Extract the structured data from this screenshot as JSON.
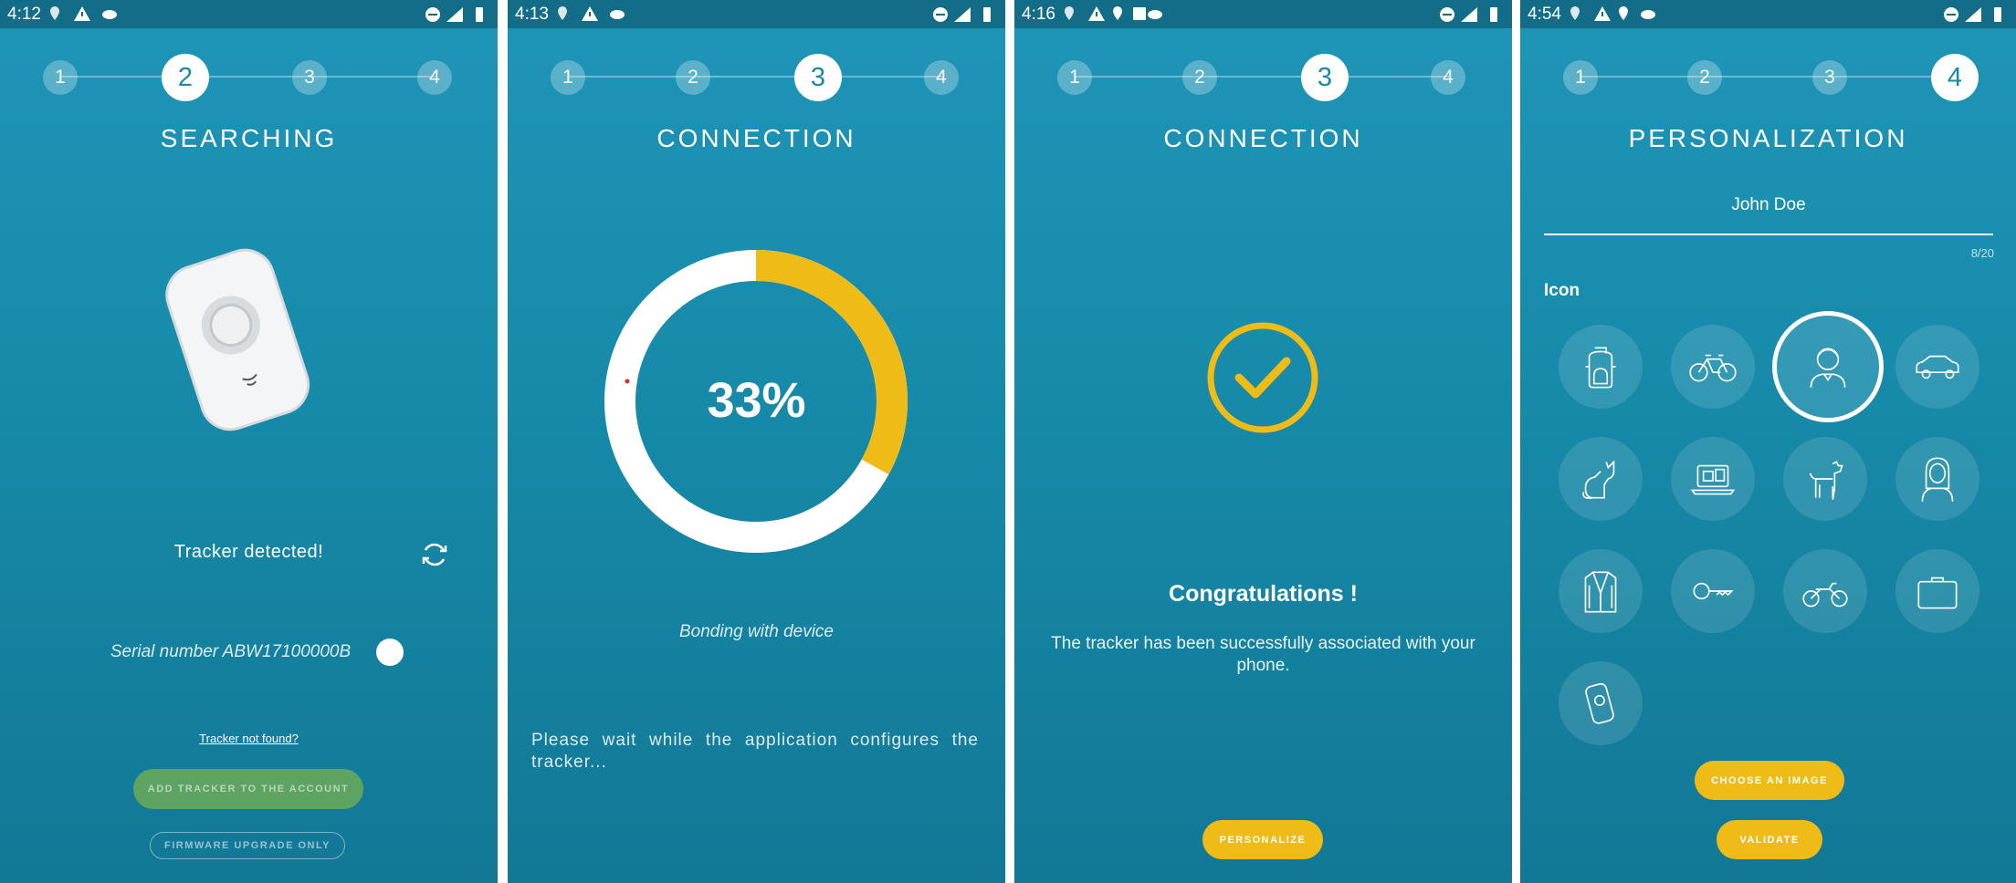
{
  "screens": [
    {
      "time": "4:12",
      "title": "SEARCHING",
      "steps": [
        "1",
        "2",
        "3",
        "4"
      ],
      "active_step": 2,
      "status": "Tracker detected!",
      "serial": "Serial number ABW17100000B",
      "link": "Tracker not found?",
      "add_button": "ADD TRACKER TO THE ACCOUNT",
      "firmware_button": "FIRMWARE UPGRADE ONLY"
    },
    {
      "time": "4:13",
      "title": "CONNECTION",
      "steps": [
        "1",
        "2",
        "3",
        "4"
      ],
      "active_step": 3,
      "percent": "33%",
      "progress": 0.33,
      "bonding": "Bonding with device",
      "wait": "Please wait while the application configures the tracker..."
    },
    {
      "time": "4:16",
      "title": "CONNECTION",
      "steps": [
        "1",
        "2",
        "3",
        "4"
      ],
      "active_step": 3,
      "congrats": "Congratulations !",
      "message": "The tracker has been successfully associated with your phone.",
      "button": "PERSONALIZE"
    },
    {
      "time": "4:54",
      "title": "PERSONALIZATION",
      "steps": [
        "1",
        "2",
        "3",
        "4"
      ],
      "active_step": 4,
      "name_value": "John Doe",
      "counter": "8/20",
      "icon_label": "Icon",
      "icons": [
        "backpack",
        "bicycle",
        "person",
        "car",
        "cat",
        "laptop",
        "dog",
        "woman",
        "jacket",
        "key",
        "motorcycle",
        "briefcase",
        "tracker"
      ],
      "selected_icon": "person",
      "choose_button": "CHOOSE AN IMAGE",
      "validate_button": "VALIDATE"
    }
  ],
  "colors": {
    "accent": "#efbc17",
    "green": "#5fa363",
    "status_bar": "#136c88"
  }
}
